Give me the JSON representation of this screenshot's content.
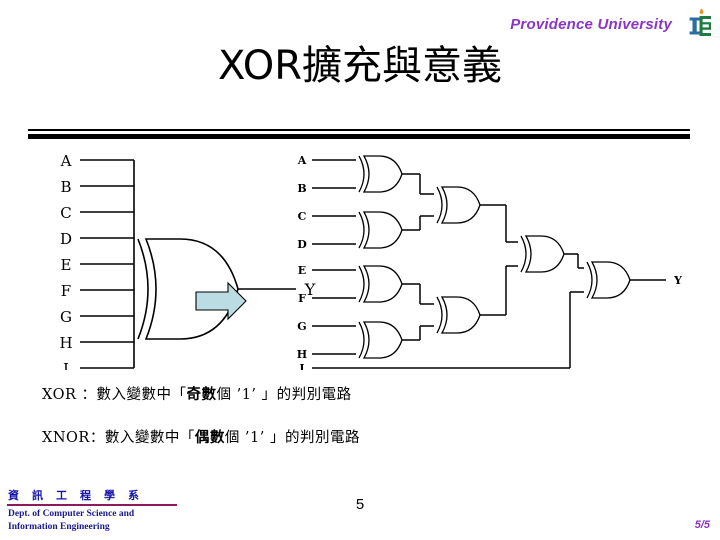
{
  "header": {
    "university": "Providence University",
    "logo_icon": "providence-university-logo-icon",
    "logo_colors": {
      "crescent": "#C3B482",
      "letter_i": "#2B6CA3",
      "letter_e": "#1F7A44",
      "flame": "#E8911C"
    },
    "brand_color": "#8B35C6"
  },
  "slide": {
    "title": "XOR擴充與意義",
    "page_number": "5",
    "page_progress": "5/5"
  },
  "figure": {
    "name": "xor-expansion-diagram",
    "arrow_icon": "right-arrow-icon",
    "arrow_fill": "#BCDCE4",
    "left_circuit": {
      "caption": "",
      "inputs": [
        "A",
        "B",
        "C",
        "D",
        "E",
        "F",
        "G",
        "H",
        "I"
      ],
      "output": "Y",
      "gate_type": "XOR",
      "gate_count": 1
    },
    "right_circuit": {
      "inputs": [
        "A",
        "B",
        "C",
        "D",
        "E",
        "F",
        "G",
        "H",
        "I"
      ],
      "output": "Y",
      "gate_type": "XOR",
      "gate_count": 8,
      "pairs": [
        [
          "A",
          "B"
        ],
        [
          "C",
          "D"
        ],
        [
          "E",
          "F"
        ],
        [
          "G",
          "H"
        ]
      ]
    }
  },
  "body": {
    "xor_label": "XOR",
    "xor_sep": " ：數入變數中「",
    "xor_bold": "奇數",
    "xor_tail": "個 ’1’ 」的判別電路",
    "xnor_label": "XNOR",
    "xnor_sep": "：數入變數中「",
    "xnor_bold": "偶數",
    "xnor_tail": "個 ’1’ 」的判別電路"
  },
  "footer": {
    "dept_cn": "資訊工程學系",
    "dept_en_line1": "Dept. of Computer Science and",
    "dept_en_line2": "Information Engineering",
    "divider_color": "#8C1A5C"
  }
}
